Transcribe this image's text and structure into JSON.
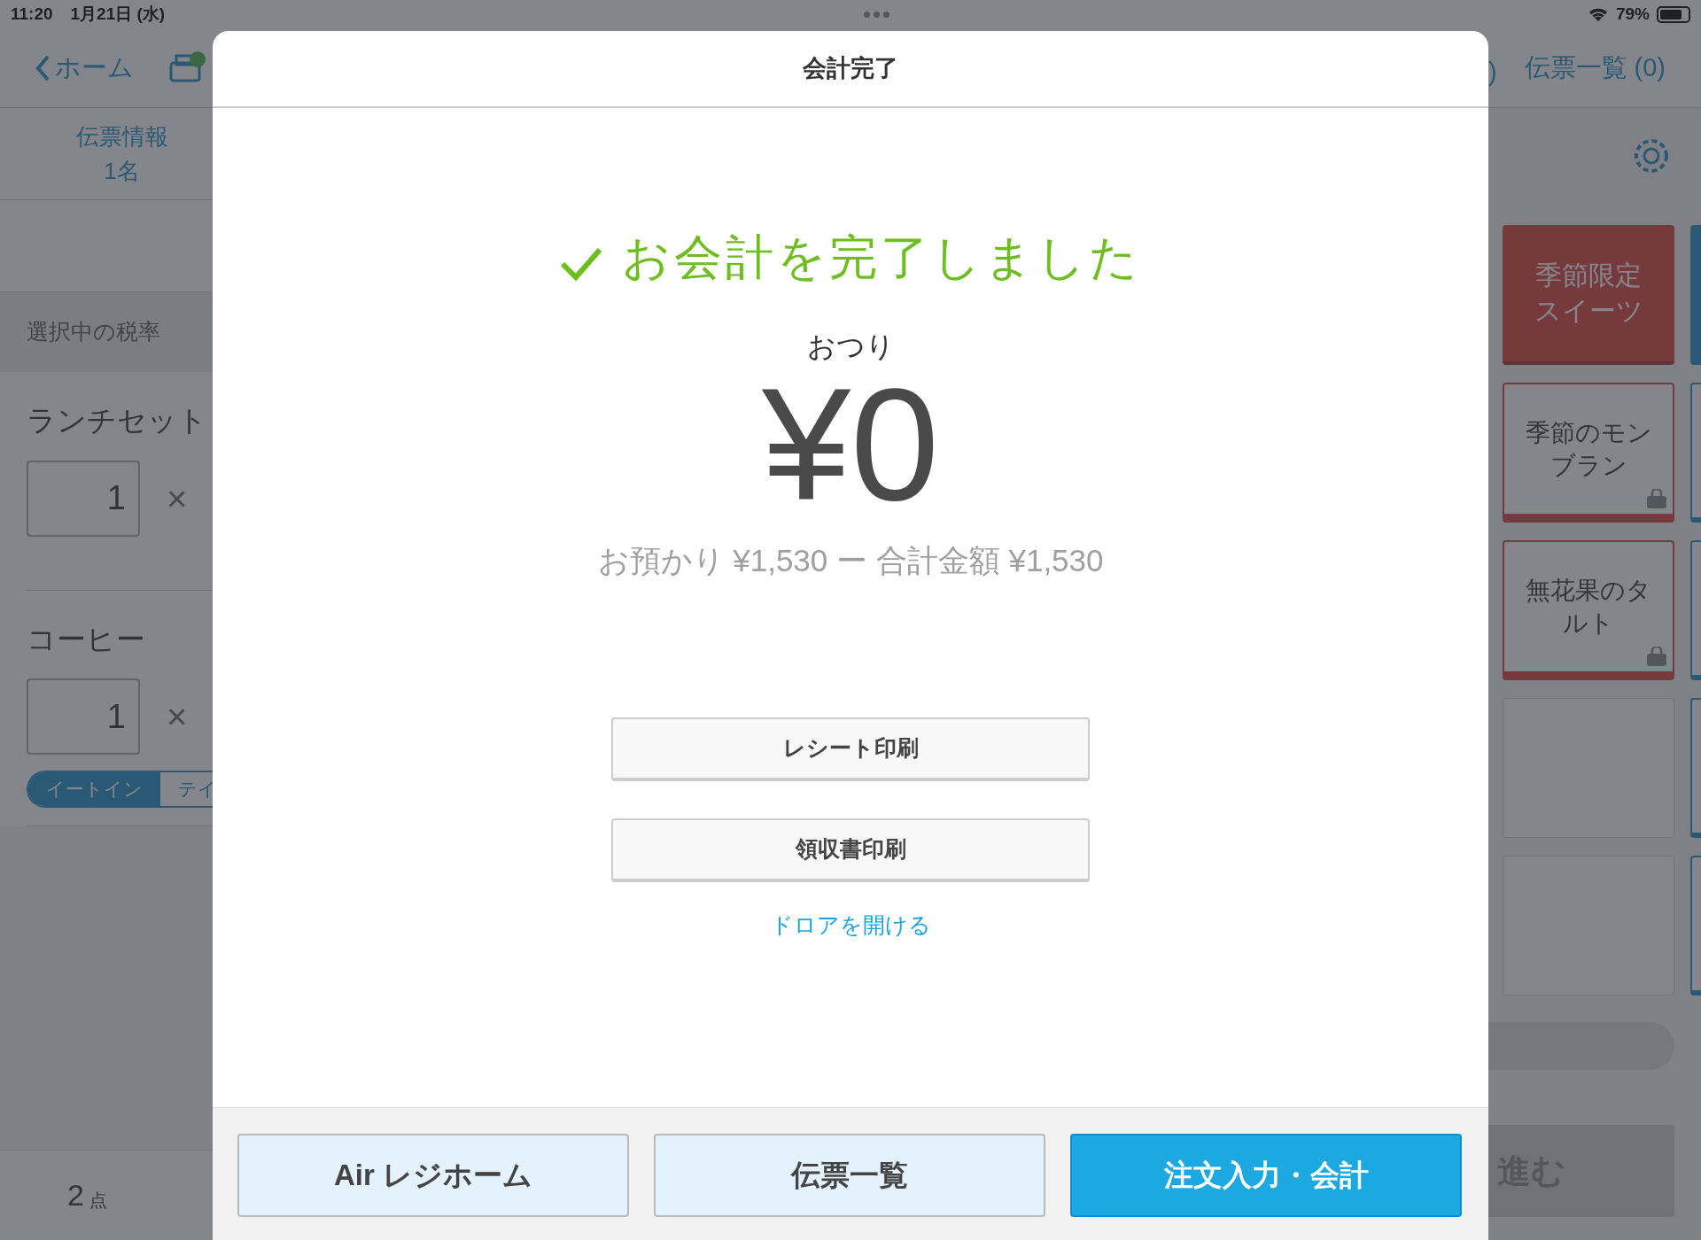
{
  "status_bar": {
    "time": "11:20",
    "date": "1月21日 (水)",
    "battery": "79%"
  },
  "nav": {
    "back": "ホーム",
    "hidden_tab_end": ")",
    "ticket_list": "伝票一覧 (0)"
  },
  "order": {
    "info_title": "伝票情報",
    "guests": "1名",
    "tax_label": "選択中の税率",
    "lines": [
      {
        "name": "ランチセット",
        "qty": "1",
        "times": "×"
      },
      {
        "name": "コーヒー",
        "qty": "1",
        "times": "×",
        "dine_options": [
          {
            "label": "イートイン",
            "selected": true
          },
          {
            "label": "テイ",
            "selected": false
          }
        ]
      }
    ],
    "count": "2",
    "count_unit": "点"
  },
  "tiles": [
    {
      "kind": "category",
      "label": "季節限定スイーツ"
    },
    {
      "kind": "item",
      "label": "季節のモンブラン"
    },
    {
      "kind": "item",
      "label": "無花果のタルト"
    },
    {
      "kind": "empty"
    },
    {
      "kind": "empty"
    }
  ],
  "next_button": "進む",
  "dialog": {
    "title": "会計完了",
    "message": "お会計を完了しました",
    "change_label": "おつり",
    "change": "¥0",
    "summary": "お預かり ¥1,530 ー 合計金額 ¥1,530",
    "actions": [
      "レシート印刷",
      "領収書印刷"
    ],
    "link": "ドロアを開ける",
    "footer": [
      {
        "label": "Air レジホーム",
        "primary": false
      },
      {
        "label": "伝票一覧",
        "primary": false
      },
      {
        "label": "注文入力・会計",
        "primary": true
      }
    ]
  }
}
